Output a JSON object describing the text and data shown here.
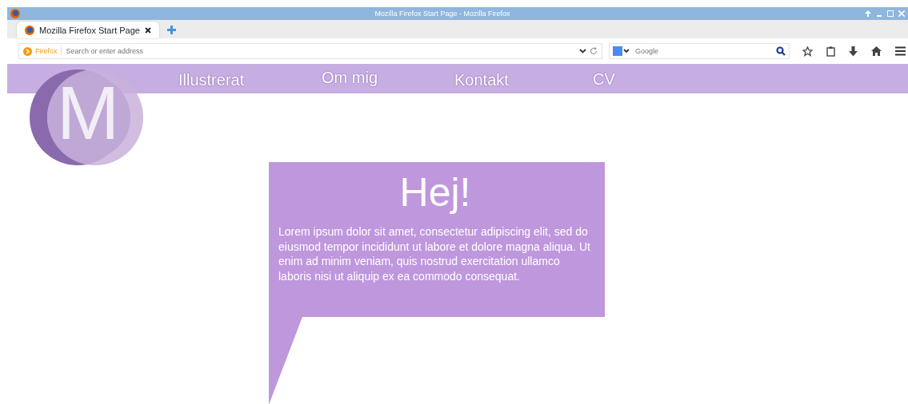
{
  "window": {
    "title": "Mozilla Firefox Start Page - Mozilla Firefox"
  },
  "tabs": [
    {
      "label": "Mozilla Firefox Start Page",
      "selected": true
    }
  ],
  "address_bar": {
    "identity": "Firefox",
    "placeholder": "Search or enter address"
  },
  "search_bar": {
    "placeholder": "Google"
  },
  "page": {
    "logo": "M",
    "nav": [
      {
        "label": "Illustrerat"
      },
      {
        "label": "Om mig"
      },
      {
        "label": "Kontakt"
      },
      {
        "label": "CV"
      }
    ],
    "bubble": {
      "heading": "Hej!",
      "text": "Lorem ipsum dolor sit amet, consectetur adipiscing elit, sed do eiusmod tempor incididunt ut labore et dolore magna aliqua. Ut enim ad minim veniam, quis nostrud exercitation ullamco laboris nisi ut aliquip ex ea commodo consequat."
    }
  }
}
